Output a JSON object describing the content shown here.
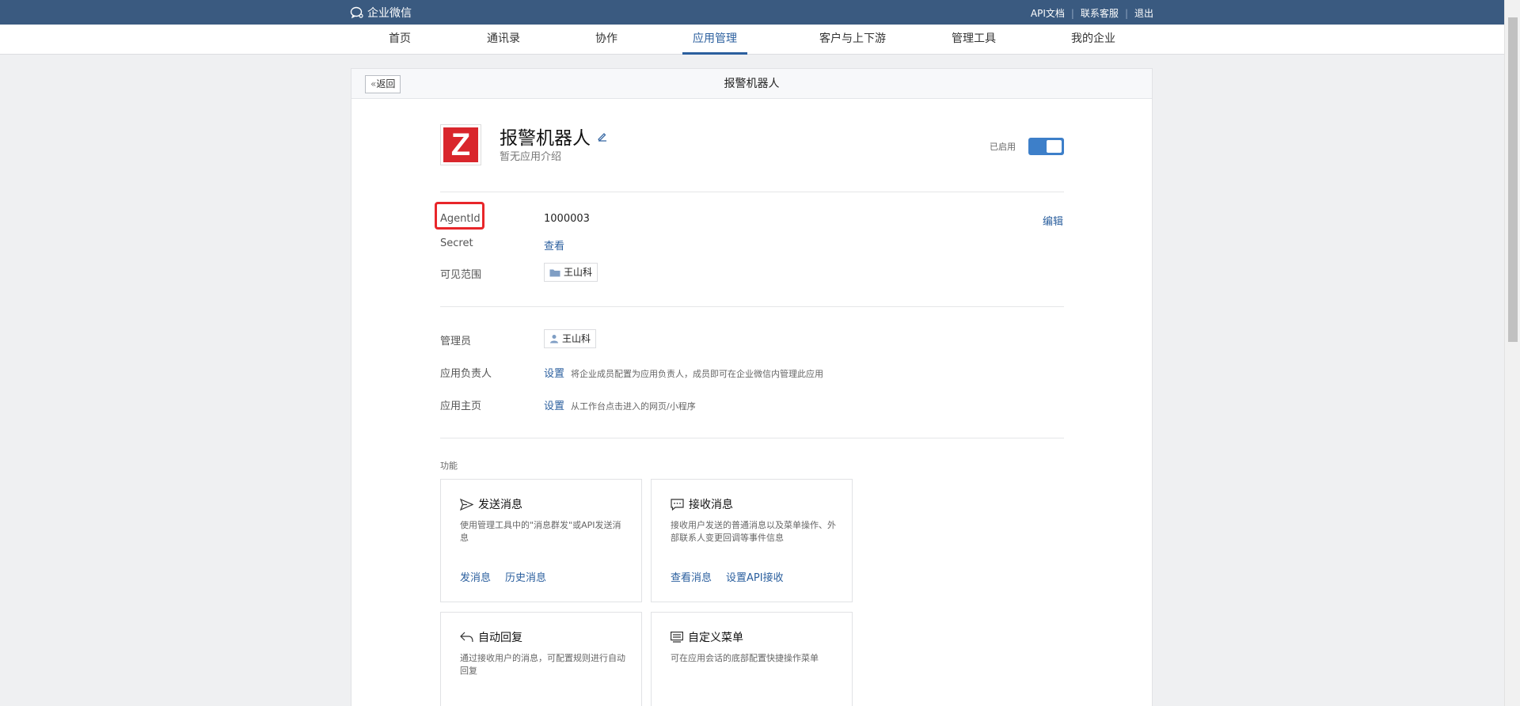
{
  "topbar": {
    "brand": "企业微信",
    "links": [
      "API文档",
      "联系客服",
      "退出"
    ],
    "separator": "|"
  },
  "nav": {
    "items": [
      "首页",
      "通讯录",
      "协作",
      "应用管理",
      "客户与上下游",
      "管理工具",
      "我的企业"
    ],
    "active": "应用管理"
  },
  "header": {
    "back_label": "返回",
    "title": "报警机器人"
  },
  "app": {
    "icon_letter": "Z",
    "name": "报警机器人",
    "description": "暂无应用介绍",
    "status_label": "已启用",
    "enabled": true
  },
  "details": {
    "agentid_label": "AgentId",
    "agentid_value": "1000003",
    "edit_label": "编辑",
    "secret_label": "Secret",
    "secret_action": "查看",
    "scope_label": "可见范围",
    "scope_value": "王山科"
  },
  "management": {
    "admin_label": "管理员",
    "admin_value": "王山科",
    "owner_label": "应用负责人",
    "owner_action": "设置",
    "owner_hint": "将企业成员配置为应用负责人，成员即可在企业微信内管理此应用",
    "homepage_label": "应用主页",
    "homepage_action": "设置",
    "homepage_hint": "从工作台点击进入的网页/小程序"
  },
  "features": {
    "section_title": "功能",
    "cards": [
      {
        "title": "发送消息",
        "desc": "使用管理工具中的\"消息群发\"或API发送消息",
        "links": [
          "发消息",
          "历史消息"
        ],
        "icon": "send-icon"
      },
      {
        "title": "接收消息",
        "desc": "接收用户发送的普通消息以及菜单操作、外部联系人变更回调等事件信息",
        "links": [
          "查看消息",
          "设置API接收"
        ],
        "icon": "chat-icon"
      },
      {
        "title": "自动回复",
        "desc": "通过接收用户的消息，可配置规则进行自动回复",
        "links": [],
        "icon": "reply-icon"
      },
      {
        "title": "自定义菜单",
        "desc": "可在应用会话的底部配置快捷操作菜单",
        "links": [],
        "icon": "menu-icon"
      }
    ]
  },
  "colors": {
    "topbar": "#3a5a80",
    "accent": "#2b5f9e",
    "toggle": "#3d7fc9",
    "highlight": "#e8262a",
    "app_icon": "#d9262c"
  }
}
